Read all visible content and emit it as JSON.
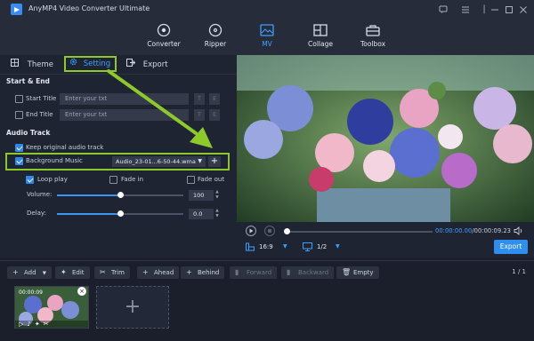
{
  "app": {
    "title": "AnyMP4 Video Converter Ultimate"
  },
  "window_controls": [
    {
      "icon": "chat-icon"
    },
    {
      "icon": "menu-icon"
    },
    {
      "icon": "minimize-icon"
    },
    {
      "icon": "maximize-icon"
    },
    {
      "icon": "close-icon"
    }
  ],
  "nav": [
    {
      "label": "Converter",
      "icon": "converter-icon"
    },
    {
      "label": "Ripper",
      "icon": "ripper-icon"
    },
    {
      "label": "MV",
      "icon": "mv-icon",
      "active": true
    },
    {
      "label": "Collage",
      "icon": "collage-icon"
    },
    {
      "label": "Toolbox",
      "icon": "toolbox-icon"
    }
  ],
  "tabs": {
    "theme": "Theme",
    "setting": "Setting",
    "export": "Export"
  },
  "start_end": {
    "heading": "Start & End",
    "start_title_label": "Start Title",
    "start_title_placeholder": "Enter your txt",
    "end_title_label": "End Title",
    "end_title_placeholder": "Enter your txt"
  },
  "audio": {
    "heading": "Audio Track",
    "keep_original_label": "Keep original audio track",
    "background_music_label": "Background Music",
    "music_file": "Audio_23-01...6-50-44.wma",
    "loop_play_label": "Loop play",
    "fade_in_label": "Fade in",
    "fade_out_label": "Fade out",
    "volume_label": "Volume:",
    "volume_value": "100",
    "delay_label": "Delay:",
    "delay_value": "0.0",
    "volume_level": 0.5,
    "delay_level": 0.5
  },
  "player": {
    "timecode": "00:00:00.00/00:00:09.23",
    "aspect": "16:9",
    "page": "1/2",
    "export_label": "Export",
    "progress": 0.0
  },
  "toolbar": {
    "add": "Add",
    "edit": "Edit",
    "trim": "Trim",
    "ahead": "Ahead",
    "behind": "Behind",
    "forward": "Forward",
    "backward": "Backward",
    "empty": "Empty",
    "pager": "1 / 1"
  },
  "clip": {
    "duration": "00:00:09"
  },
  "colors": {
    "accent": "#2f8ff0",
    "highlight": "#8ec92b",
    "bg": "#1f2433"
  }
}
